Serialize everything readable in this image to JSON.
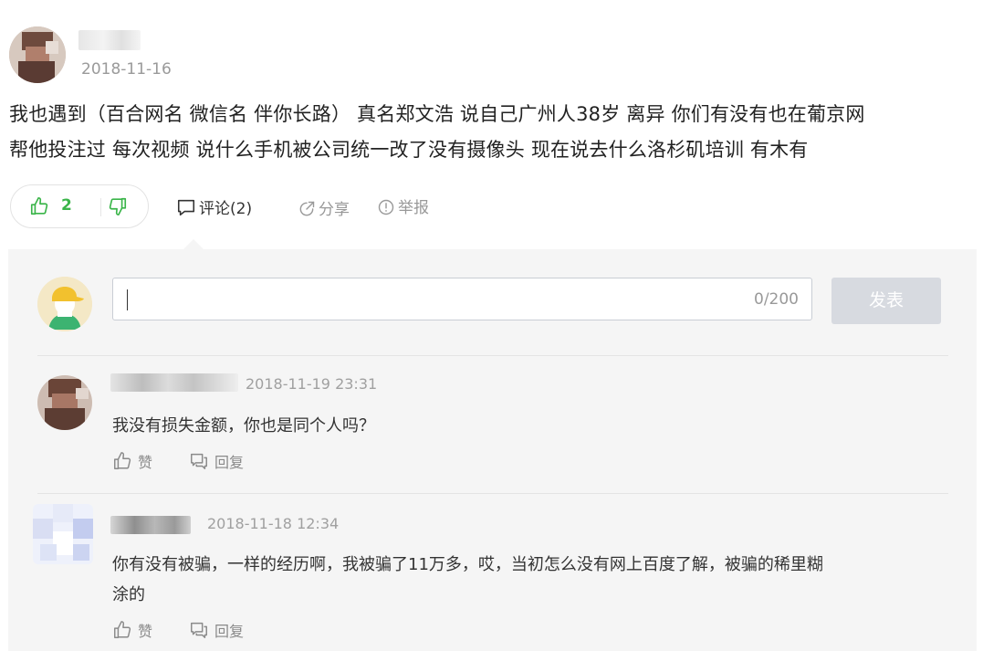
{
  "post": {
    "date": "2018-11-16",
    "body_line1": "我也遇到（百合网名 微信名 伴你长路） 真名郑文浩 说自己广州人38岁 离异 你们有没有也在葡京网",
    "body_line2": "帮他投注过 每次视频 说什么手机被公司统一改了没有摄像头 现在说去什么洛杉矶培训 有木有",
    "like_count": "2",
    "comment_label": "评论(2)",
    "share_label": "分享",
    "report_label": "举报"
  },
  "composer": {
    "value": "",
    "counter": "0/200",
    "submit_label": "发表"
  },
  "comments": [
    {
      "date": "2018-11-19 23:31",
      "text": "我没有损失金额，你也是同个人吗？",
      "like_label": "赞",
      "reply_label": "回复"
    },
    {
      "date": "2018-11-18 12:34",
      "text_line1": "你有没有被骗，一样的经历啊，我被骗了11万多，哎，当初怎么没有网上百度了解，被骗的稀里糊",
      "text_line2": "涂的",
      "like_label": "赞",
      "reply_label": "回复"
    }
  ],
  "colors": {
    "accent_green": "#3bb54a",
    "panel_bg": "#f5f5f5",
    "submit_disabled": "#d7dae0"
  },
  "icons": [
    "thumbs-up-icon",
    "thumbs-down-icon",
    "comment-bubble-icon",
    "share-icon",
    "report-icon",
    "reply-icon"
  ]
}
